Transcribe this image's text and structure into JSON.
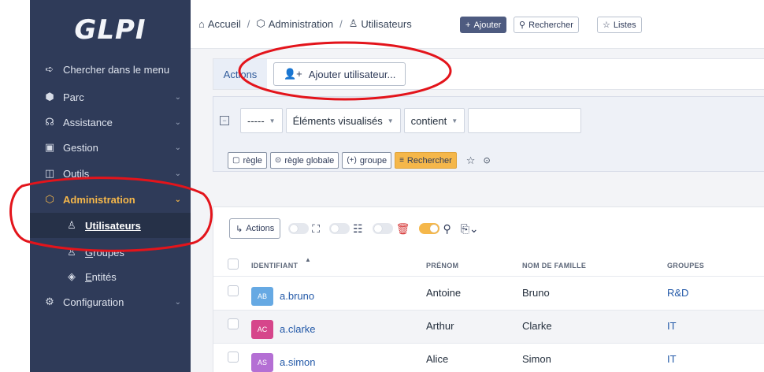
{
  "colors": {
    "sidebar_bg": "#2f3b59",
    "accent": "#f5b74a",
    "annotation": "#e3141b",
    "link": "#2359a8"
  },
  "logo": {
    "text": "GLPI"
  },
  "sidebar": {
    "items": [
      {
        "label": "Chercher dans le menu",
        "icon": "arrow-right-icon"
      },
      {
        "label": "Parc",
        "icon": "box-icon"
      },
      {
        "label": "Assistance",
        "icon": "headset-icon"
      },
      {
        "label": "Gestion",
        "icon": "wallet-icon"
      },
      {
        "label": "Outils",
        "icon": "briefcase-icon"
      },
      {
        "label": "Administration",
        "icon": "shield-icon"
      },
      {
        "label": "Utilisateurs",
        "icon": "user-icon"
      },
      {
        "label": "Groupes",
        "icon": "users-icon"
      },
      {
        "label": "Entités",
        "icon": "stack-icon"
      },
      {
        "label": "Configuration",
        "icon": "gear-icon"
      }
    ]
  },
  "topbar": {
    "breadcrumb": [
      "Accueil",
      "Administration",
      "Utilisateurs"
    ],
    "add_label": "Ajouter",
    "search_label": "Rechercher",
    "lists_label": "Listes"
  },
  "actions_bar": {
    "tab_label": "Actions",
    "add_user_label": "Ajouter utilisateur..."
  },
  "search": {
    "field1": "-----",
    "field2": "Éléments visualisés",
    "field3": "contient",
    "value": "",
    "rule_label": "règle",
    "global_rule_label": "règle globale",
    "group_label": "groupe",
    "search_label": "Rechercher"
  },
  "list": {
    "actions_label": "Actions",
    "columns": [
      "IDENTIFIANT",
      "PRÉNOM",
      "NOM DE FAMILLE",
      "GROUPES"
    ],
    "rows": [
      {
        "initials": "AB",
        "avatar_color": "#66a9e3",
        "login": "a.bruno",
        "first": "Antoine",
        "last": "Bruno",
        "group": "R&D"
      },
      {
        "initials": "AC",
        "avatar_color": "#d6468b",
        "login": "a.clarke",
        "first": "Arthur",
        "last": "Clarke",
        "group": "IT"
      },
      {
        "initials": "AS",
        "avatar_color": "#b46fd4",
        "login": "a.simon",
        "first": "Alice",
        "last": "Simon",
        "group": "IT"
      }
    ]
  }
}
